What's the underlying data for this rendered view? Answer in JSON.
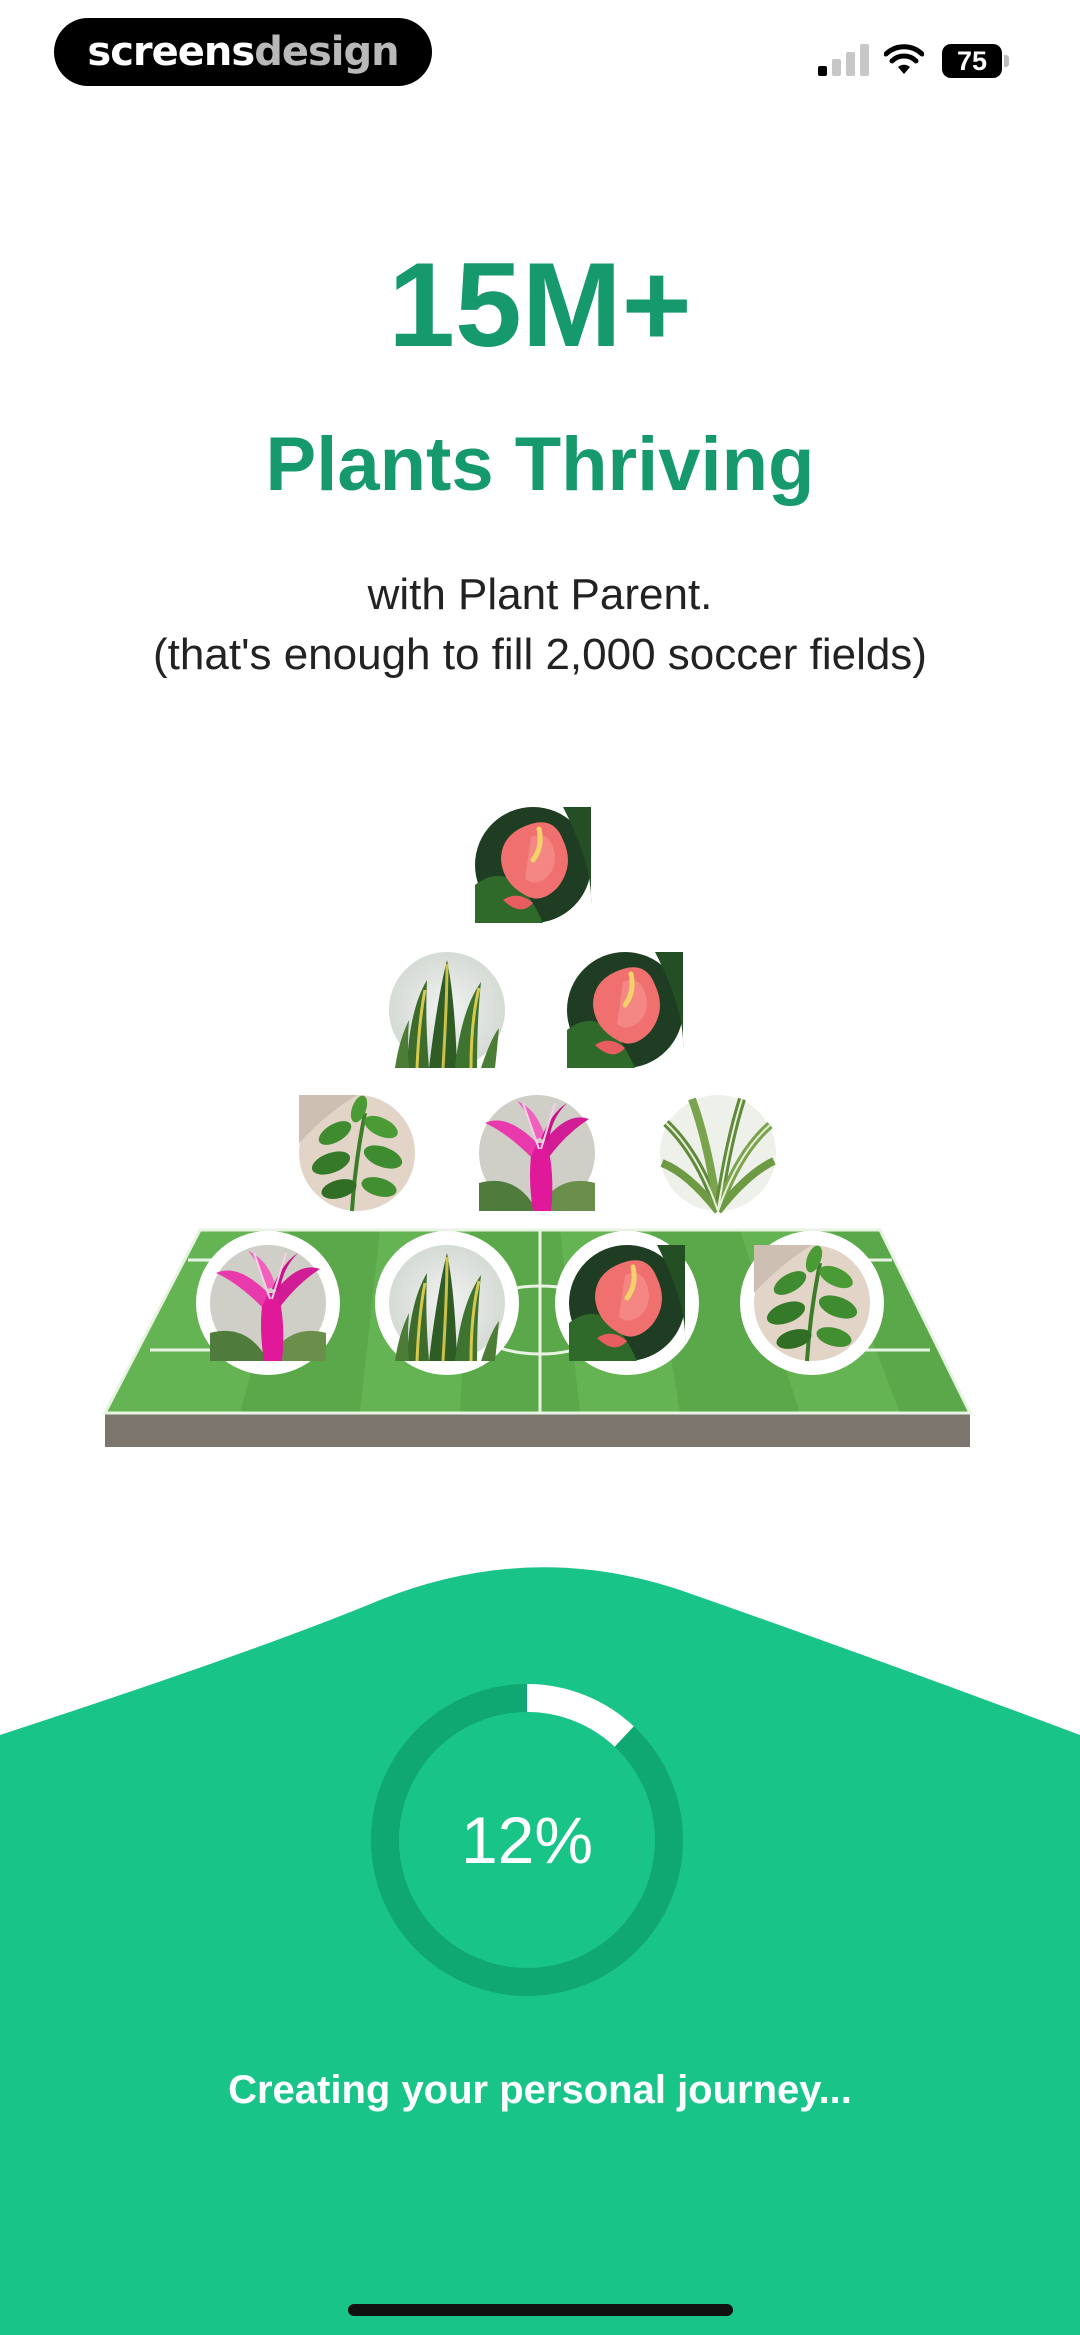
{
  "status_bar": {
    "brand_part1": "screens",
    "brand_part2": "design",
    "battery_level": "75",
    "signal_icon": "cellular-signal-icon",
    "wifi_icon": "wifi-icon",
    "battery_icon": "battery-icon"
  },
  "hero": {
    "headline": "15M+",
    "subheadline": "Plants Thriving",
    "description_line1": "with Plant Parent.",
    "description_line2": "(that's enough to fill 2,000 soccer fields)"
  },
  "illustration": {
    "field_color": "#5aa84a",
    "plants": [
      "anthurium",
      "snake-plant",
      "anthurium",
      "zz-plant",
      "christmas-cactus",
      "dracaena",
      "christmas-cactus",
      "snake-plant",
      "anthurium",
      "zz-plant"
    ]
  },
  "progress": {
    "value": 0.12,
    "label": "12%",
    "caption": "Creating your personal journey..."
  },
  "colors": {
    "brand_green": "#16996d",
    "panel_green": "#19c488",
    "ring_track": "#0fa772"
  }
}
